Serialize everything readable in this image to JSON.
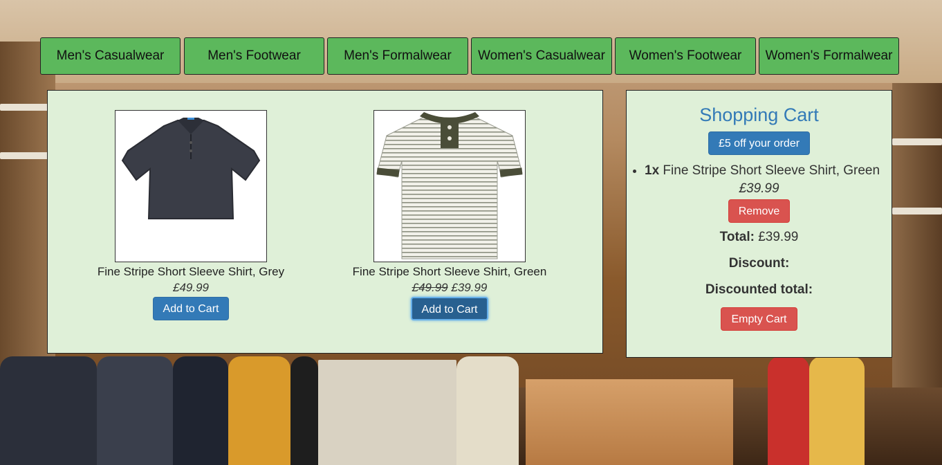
{
  "nav": {
    "items": [
      {
        "label": "Men's Casualwear"
      },
      {
        "label": "Men's Footwear"
      },
      {
        "label": "Men's Formalwear"
      },
      {
        "label": "Women's Casualwear"
      },
      {
        "label": "Women's Footwear"
      },
      {
        "label": "Women's Formalwear"
      }
    ]
  },
  "products": [
    {
      "name": "Fine Stripe Short Sleeve Shirt, Grey",
      "price": "£49.99",
      "button": "Add to Cart",
      "image": "grey-polo-shirt"
    },
    {
      "name": "Fine Stripe Short Sleeve Shirt, Green",
      "old_price": "£49.99",
      "price": "£39.99",
      "button": "Add to Cart",
      "image": "green-striped-henley-shirt"
    }
  ],
  "cart": {
    "title": "Shopping Cart",
    "voucher_button": "£5 off your order",
    "items": [
      {
        "qty": "1x",
        "name": "Fine Stripe Short Sleeve Shirt, Green",
        "price": "£39.99",
        "remove_label": "Remove"
      }
    ],
    "total_label": "Total:",
    "total_value": "£39.99",
    "discount_label": "Discount:",
    "discounted_total_label": "Discounted total:",
    "empty_button": "Empty Cart"
  },
  "colors": {
    "nav_button": "#5cb85c",
    "panel_bg": "#dff0d8",
    "primary": "#337ab7",
    "danger": "#d9534f"
  }
}
